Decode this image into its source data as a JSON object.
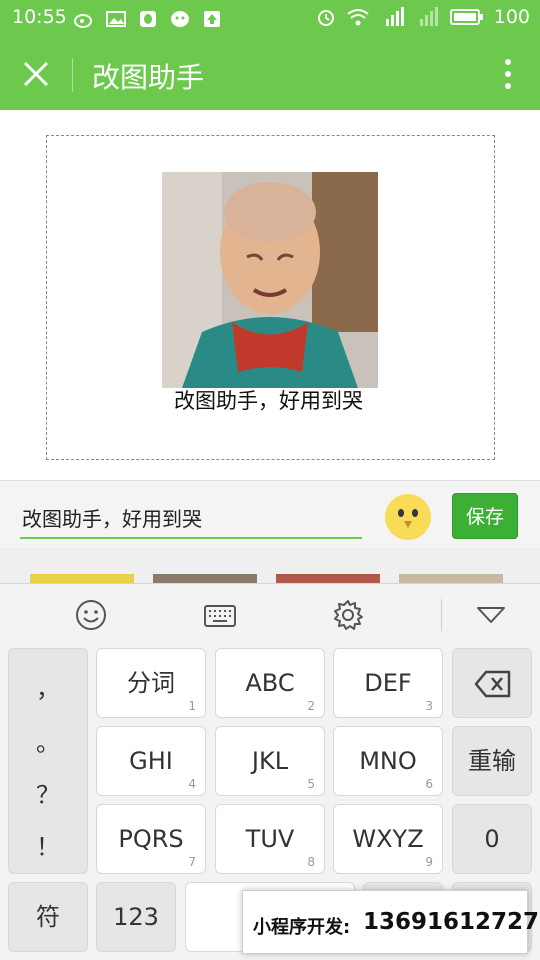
{
  "status_bar": {
    "time": "10:55",
    "battery": "100"
  },
  "title_bar": {
    "title": "改图助手"
  },
  "editor": {
    "caption": "改图助手，好用到哭"
  },
  "input": {
    "value": "改图助手，好用到哭",
    "save_label": "保存"
  },
  "keyboard": {
    "punct": [
      "，",
      "。",
      "？",
      "！"
    ],
    "keys": [
      {
        "label": "分词",
        "num": "1"
      },
      {
        "label": "ABC",
        "num": "2"
      },
      {
        "label": "DEF",
        "num": "3"
      },
      {
        "label": "GHI",
        "num": "4"
      },
      {
        "label": "JKL",
        "num": "5"
      },
      {
        "label": "MNO",
        "num": "6"
      },
      {
        "label": "PQRS",
        "num": "7"
      },
      {
        "label": "TUV",
        "num": "8"
      },
      {
        "label": "WXYZ",
        "num": "9"
      }
    ],
    "reenter": "重输",
    "zero": "0",
    "symbol": "符",
    "num123": "123"
  },
  "watermark": {
    "label": "小程序开发:",
    "phone": "13691612727"
  },
  "colors": {
    "brand_green": "#6dc94d",
    "save_green": "#3cb034"
  },
  "icons": [
    "close-icon",
    "more-icon",
    "smiley-icon",
    "keyboard-icon",
    "gear-icon",
    "collapse-icon",
    "backspace-icon"
  ]
}
